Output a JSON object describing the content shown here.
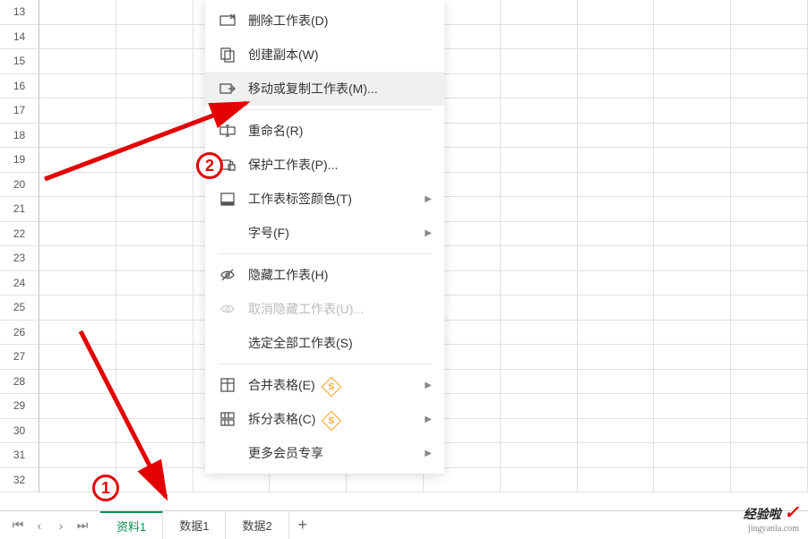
{
  "rows": [
    13,
    14,
    15,
    16,
    17,
    18,
    19,
    20,
    21,
    22,
    23,
    24,
    25,
    26,
    27,
    28,
    29,
    30,
    31,
    32
  ],
  "tabs": [
    {
      "label": "资料1",
      "active": true
    },
    {
      "label": "数据1",
      "active": false
    },
    {
      "label": "数据2",
      "active": false
    }
  ],
  "menu": {
    "delete": "删除工作表(D)",
    "copy": "创建副本(W)",
    "move": "移动或复制工作表(M)...",
    "rename": "重命名(R)",
    "protect": "保护工作表(P)...",
    "tabcolor": "工作表标签颜色(T)",
    "fontsize": "字号(F)",
    "hide": "隐藏工作表(H)",
    "unhide": "取消隐藏工作表(U)...",
    "selectall": "选定全部工作表(S)",
    "merge": "合并表格(E)",
    "split": "拆分表格(C)",
    "vip": "更多会员专享"
  },
  "annotations": {
    "a1": "1",
    "a2": "2"
  },
  "watermark": {
    "main": "经验啦",
    "sub": "jingyanla.com"
  }
}
